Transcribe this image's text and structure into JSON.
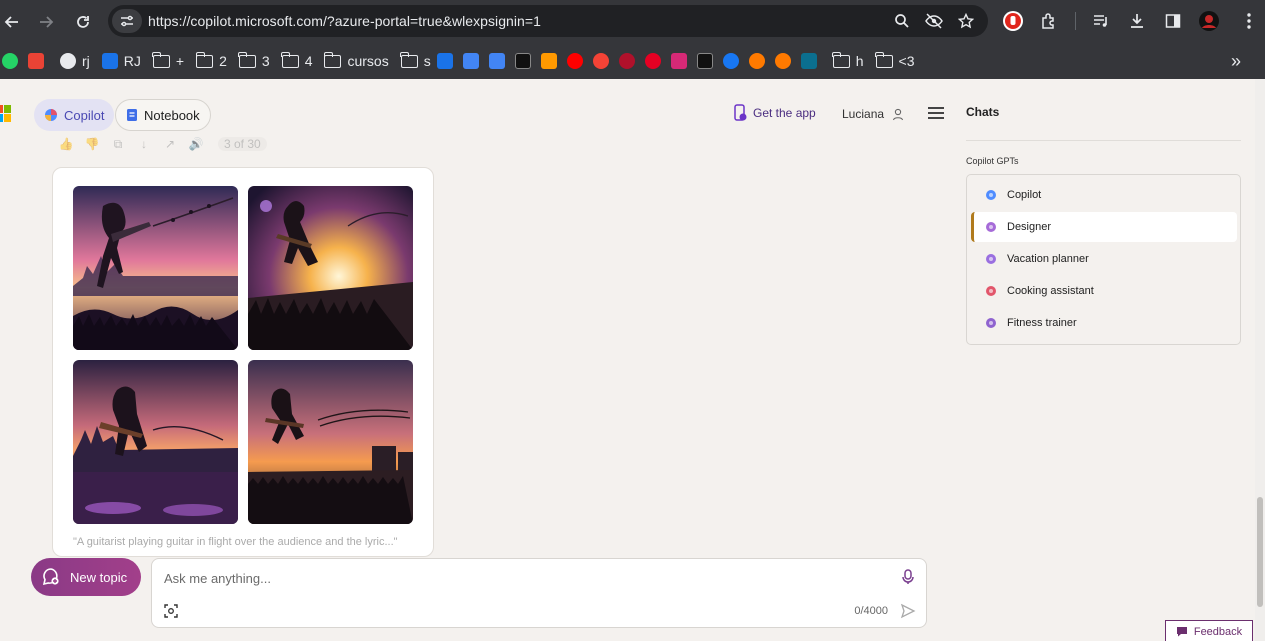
{
  "browser": {
    "url": "https://copilot.microsoft.com/?azure-portal=true&wlexpsignin=1",
    "bookmarks": [
      {
        "label": "",
        "icon": "whatsapp-icon",
        "color": "#25d366"
      },
      {
        "label": "",
        "icon": "gmail-icon",
        "color": "#ea4335"
      },
      {
        "label": "rj",
        "icon": "globe-icon",
        "color": "#e8eaed"
      },
      {
        "label": "RJ",
        "icon": "site-icon",
        "color": "#1a73e8"
      },
      {
        "label": "+",
        "icon": "folder-icon"
      },
      {
        "label": "2",
        "icon": "folder-icon"
      },
      {
        "label": "3",
        "icon": "folder-icon"
      },
      {
        "label": "4",
        "icon": "folder-icon"
      },
      {
        "label": "cursos",
        "icon": "folder-icon"
      },
      {
        "label": "s",
        "icon": "folder-icon"
      },
      {
        "label": "",
        "icon": "calendar-icon",
        "color": "#1a73e8"
      },
      {
        "label": "",
        "icon": "translate-icon",
        "color": "#4285f4"
      },
      {
        "label": "",
        "icon": "assistant-icon",
        "color": "#4285f4"
      },
      {
        "label": "",
        "icon": "k-icon",
        "color": "#ffffff"
      },
      {
        "label": "",
        "icon": "amazon-icon",
        "color": "#ff9900"
      },
      {
        "label": "",
        "icon": "youtube-music-icon",
        "color": "#ff0000"
      },
      {
        "label": "",
        "icon": "red-orange-icon",
        "color": "#f44336"
      },
      {
        "label": "",
        "icon": "dark-red-icon",
        "color": "#b0112b"
      },
      {
        "label": "",
        "icon": "pinterest-icon",
        "color": "#e60023"
      },
      {
        "label": "",
        "icon": "instagram-icon",
        "color": "#d62976"
      },
      {
        "label": "",
        "icon": "x-icon",
        "color": "#ffffff"
      },
      {
        "label": "",
        "icon": "facebook-icon",
        "color": "#1877f2"
      },
      {
        "label": "",
        "icon": "orange-ring-icon",
        "color": "#ff7a00"
      },
      {
        "label": "",
        "icon": "orange-ring-icon",
        "color": "#ff7a00"
      },
      {
        "label": "",
        "icon": "e-icon",
        "color": "#0b6f8f"
      },
      {
        "label": "h",
        "icon": "folder-icon"
      },
      {
        "label": "<3",
        "icon": "folder-icon"
      }
    ]
  },
  "header": {
    "copilot_label": "Copilot",
    "notebook_label": "Notebook",
    "get_app_label": "Get the app",
    "user_name": "Luciana"
  },
  "result": {
    "counter": "3 of 30",
    "caption": "\"A guitarist playing guitar in flight over the audience and the lyric...\""
  },
  "composer": {
    "new_topic_label": "New topic",
    "placeholder": "Ask me anything...",
    "char_count": "0/4000"
  },
  "sidebar": {
    "title": "Chats",
    "gpts_label": "Copilot GPTs",
    "items": [
      {
        "label": "Copilot",
        "color": "#4f8cff"
      },
      {
        "label": "Designer",
        "color": "#a66bd8"
      },
      {
        "label": "Vacation planner",
        "color": "#9a6fe0"
      },
      {
        "label": "Cooking assistant",
        "color": "#e2566b"
      },
      {
        "label": "Fitness trainer",
        "color": "#8f63cf"
      }
    ]
  },
  "feedback_label": "Feedback"
}
